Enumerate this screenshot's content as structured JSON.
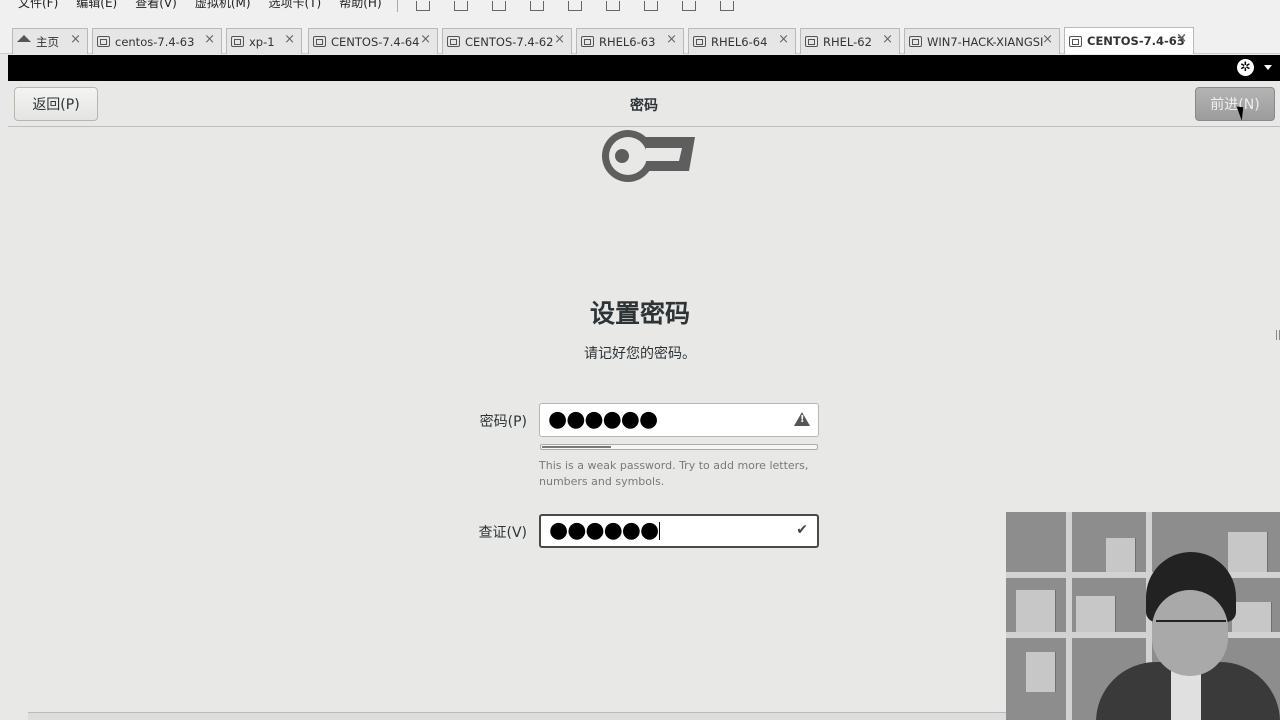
{
  "menubar": {
    "items": [
      "文件(F)",
      "编辑(E)",
      "查看(V)",
      "虚拟机(M)",
      "选项卡(T)",
      "帮助(H)"
    ]
  },
  "tabs": [
    {
      "label": "主页",
      "icon": "home-icon",
      "active": false
    },
    {
      "label": "centos-7.4-63",
      "icon": "vm-icon",
      "active": false
    },
    {
      "label": "xp-1",
      "icon": "vm-icon",
      "active": false
    },
    {
      "label": "CENTOS-7.4-64",
      "icon": "vm-icon",
      "active": false
    },
    {
      "label": "CENTOS-7.4-62",
      "icon": "vm-icon",
      "active": false
    },
    {
      "label": "RHEL6-63",
      "icon": "vm-icon",
      "active": false
    },
    {
      "label": "RHEL6-64",
      "icon": "vm-icon",
      "active": false
    },
    {
      "label": "RHEL-62",
      "icon": "vm-icon",
      "active": false
    },
    {
      "label": "WIN7-HACK-XIANGSI",
      "icon": "vm-icon",
      "active": false
    },
    {
      "label": "CENTOS-7.4-63",
      "icon": "vm-icon",
      "active": true
    }
  ],
  "header": {
    "back_label": "返回(P)",
    "title": "密码",
    "next_label": "前进(N)"
  },
  "main": {
    "heading": "设置密码",
    "subheading": "请记好您的密码。",
    "password": {
      "label": "密码(P)",
      "value": "●●●●●●",
      "status_icon": "warning-icon"
    },
    "strength": {
      "level": 0.25,
      "hint": "This is a weak password. Try to add more letters, numbers and symbols."
    },
    "confirm": {
      "label": "查证(V)",
      "value": "●●●●●●",
      "status_icon": "checkmark-icon"
    }
  },
  "colors": {
    "guest_background": "#e8e8e7",
    "top_bar": "#000000",
    "next_button": "#a3a3a3"
  }
}
